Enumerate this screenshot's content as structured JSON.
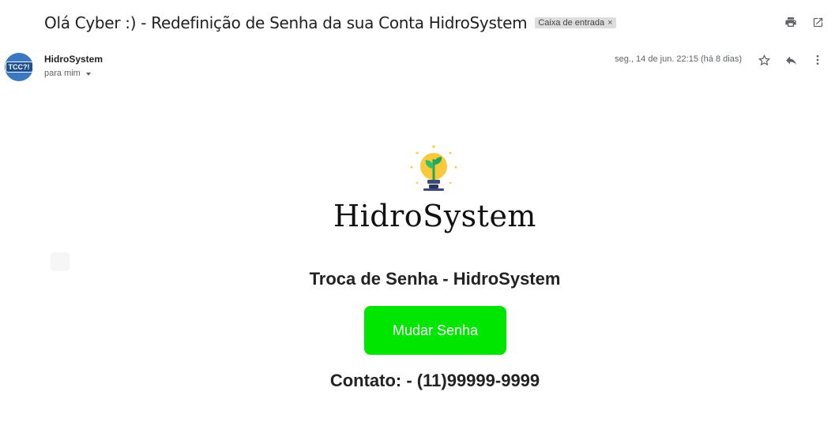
{
  "email": {
    "subject": "Olá Cyber :) - Redefinição de Senha da sua Conta HidroSystem",
    "label": "Caixa de entrada",
    "label_close": "×",
    "sender_name": "HidroSystem",
    "recipient": "para mim",
    "date": "seg., 14 de jun. 22:15 (há 8 dias)",
    "avatar_text": "TCC?!"
  },
  "icons": {
    "print": "print-icon",
    "new_window": "open-in-new-window-icon",
    "star": "star-icon",
    "reply": "reply-icon",
    "more": "more-vert-icon"
  },
  "body": {
    "brand": "HidroSystem",
    "heading": "Troca de Senha - HidroSystem",
    "button": "Mudar Senha",
    "contact": "Contato: - (11)99999-9999"
  },
  "colors": {
    "button": "#00e600",
    "bulb": "#f9c93a",
    "leaf": "#22a65a"
  }
}
